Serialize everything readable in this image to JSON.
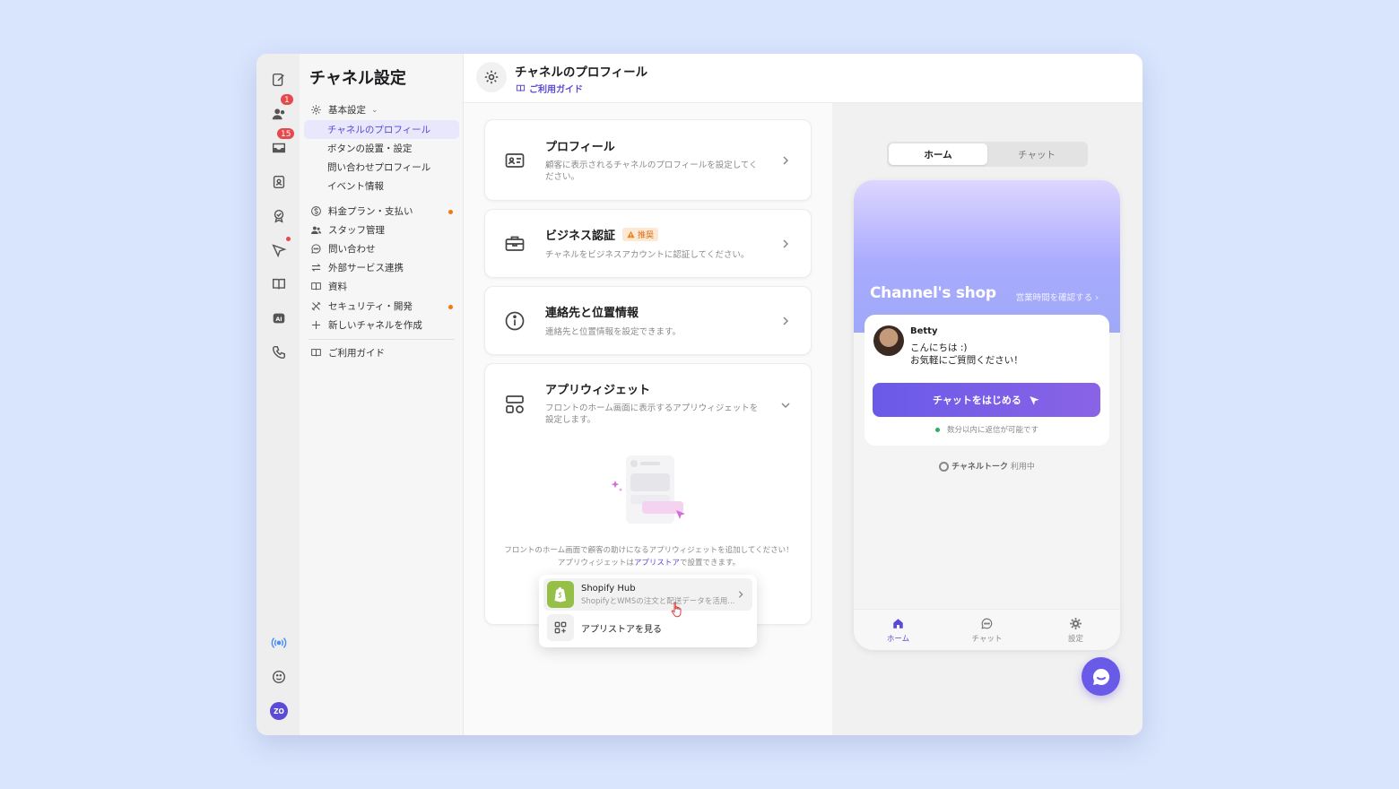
{
  "rail": {
    "contacts_badge": "1",
    "inbox_badge": "15",
    "avatar_initials": "ZO"
  },
  "nav": {
    "title": "チャネル設定",
    "group_basic": "基本設定",
    "sub_items": [
      "チャネルのプロフィール",
      "ボタンの設置・設定",
      "問い合わせプロフィール",
      "イベント情報"
    ],
    "items": [
      "料金プラン・支払い",
      "スタッフ管理",
      "問い合わせ",
      "外部サービス連携",
      "資料",
      "セキュリティ・開発",
      "新しいチャネルを作成"
    ],
    "guide": "ご利用ガイド"
  },
  "header": {
    "title": "チャネルのプロフィール",
    "guide_link": "ご利用ガイド"
  },
  "cards": {
    "profile": {
      "title": "プロフィール",
      "desc": "顧客に表示されるチャネルのプロフィールを設定してください。"
    },
    "business": {
      "title": "ビジネス認証",
      "badge": "推奨",
      "desc": "チャネルをビジネスアカウントに認証してください。"
    },
    "contact": {
      "title": "連絡先と位置情報",
      "desc": "連絡先と位置情報を設定できます。"
    },
    "widget": {
      "title": "アプリウィジェット",
      "desc": "フロントのホーム画面に表示するアプリウィジェットを設定します。",
      "empty_line1": "フロントのホーム画面で顧客の助けになるアプリウィジェットを追加してください！",
      "empty_line2_pre": "アプリウィジェットは",
      "empty_line2_link": "アプリストア",
      "empty_line2_post": "で設置できます。"
    }
  },
  "popup": {
    "shopify_name": "Shopify Hub",
    "shopify_desc": "ShopifyとWMSの注文と配送データを活用...",
    "appstore": "アプリストアを見る"
  },
  "preview": {
    "tab_home": "ホーム",
    "tab_chat": "チャット",
    "shop_name": "Channel's shop",
    "hours_link": "営業時間を確認する",
    "sender": "Betty",
    "message_line1": "こんにちは :)",
    "message_line2": "お気軽にご質問ください！",
    "start_button": "チャットをはじめる",
    "reply_time": "数分以内に返信が可能です",
    "powered_brand": "チャネルトーク",
    "powered_suffix": "利用中",
    "bottom_tabs": [
      "ホーム",
      "チャット",
      "設定"
    ]
  },
  "colors": {
    "accent": "#5b4ad6",
    "background": "#d9e5fd",
    "badge_red": "#e5484d",
    "dot_orange": "#f07a12"
  }
}
